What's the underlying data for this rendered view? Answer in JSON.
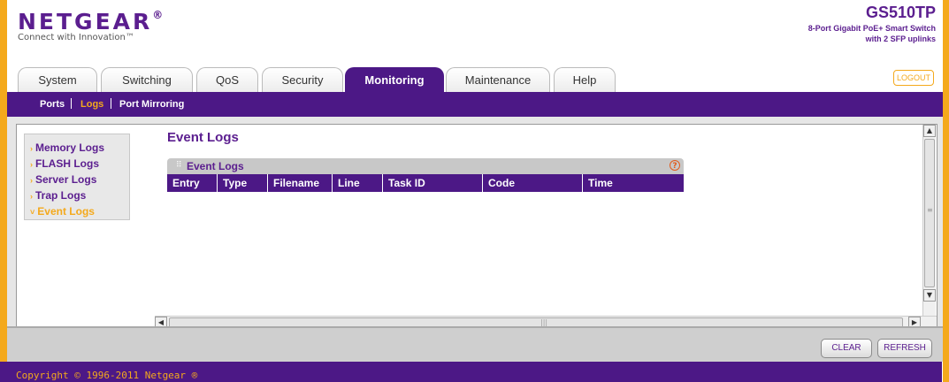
{
  "header": {
    "logo": "NETGEAR",
    "logo_mark": "®",
    "tagline": "Connect with Innovation™",
    "model": "GS510TP",
    "model_desc_line1": "8-Port Gigabit PoE+ Smart Switch",
    "model_desc_line2": "with 2 SFP uplinks",
    "logout_label": "LOGOUT"
  },
  "tabs": [
    {
      "label": "System",
      "active": false
    },
    {
      "label": "Switching",
      "active": false
    },
    {
      "label": "QoS",
      "active": false
    },
    {
      "label": "Security",
      "active": false
    },
    {
      "label": "Monitoring",
      "active": true
    },
    {
      "label": "Maintenance",
      "active": false
    },
    {
      "label": "Help",
      "active": false
    }
  ],
  "subnav": [
    {
      "label": "Ports",
      "active": false
    },
    {
      "label": "Logs",
      "active": true
    },
    {
      "label": "Port Mirroring",
      "active": false
    }
  ],
  "sidebar": {
    "items": [
      {
        "label": "Memory Logs",
        "active": false
      },
      {
        "label": "FLASH Logs",
        "active": false
      },
      {
        "label": "Server Logs",
        "active": false
      },
      {
        "label": "Trap Logs",
        "active": false
      },
      {
        "label": "Event Logs",
        "active": true
      }
    ]
  },
  "main": {
    "page_title": "Event Logs",
    "panel_title": "Event Logs",
    "columns": [
      "Entry",
      "Type",
      "Filename",
      "Line",
      "Task ID",
      "Code",
      "Time"
    ],
    "rows": []
  },
  "actions": {
    "clear_label": "CLEAR",
    "refresh_label": "REFRESH"
  },
  "footer": {
    "copyright": "Copyright © 1996-2011 Netgear ®"
  },
  "colors": {
    "brand_purple": "#4c1886",
    "accent_orange": "#f4a91c"
  }
}
